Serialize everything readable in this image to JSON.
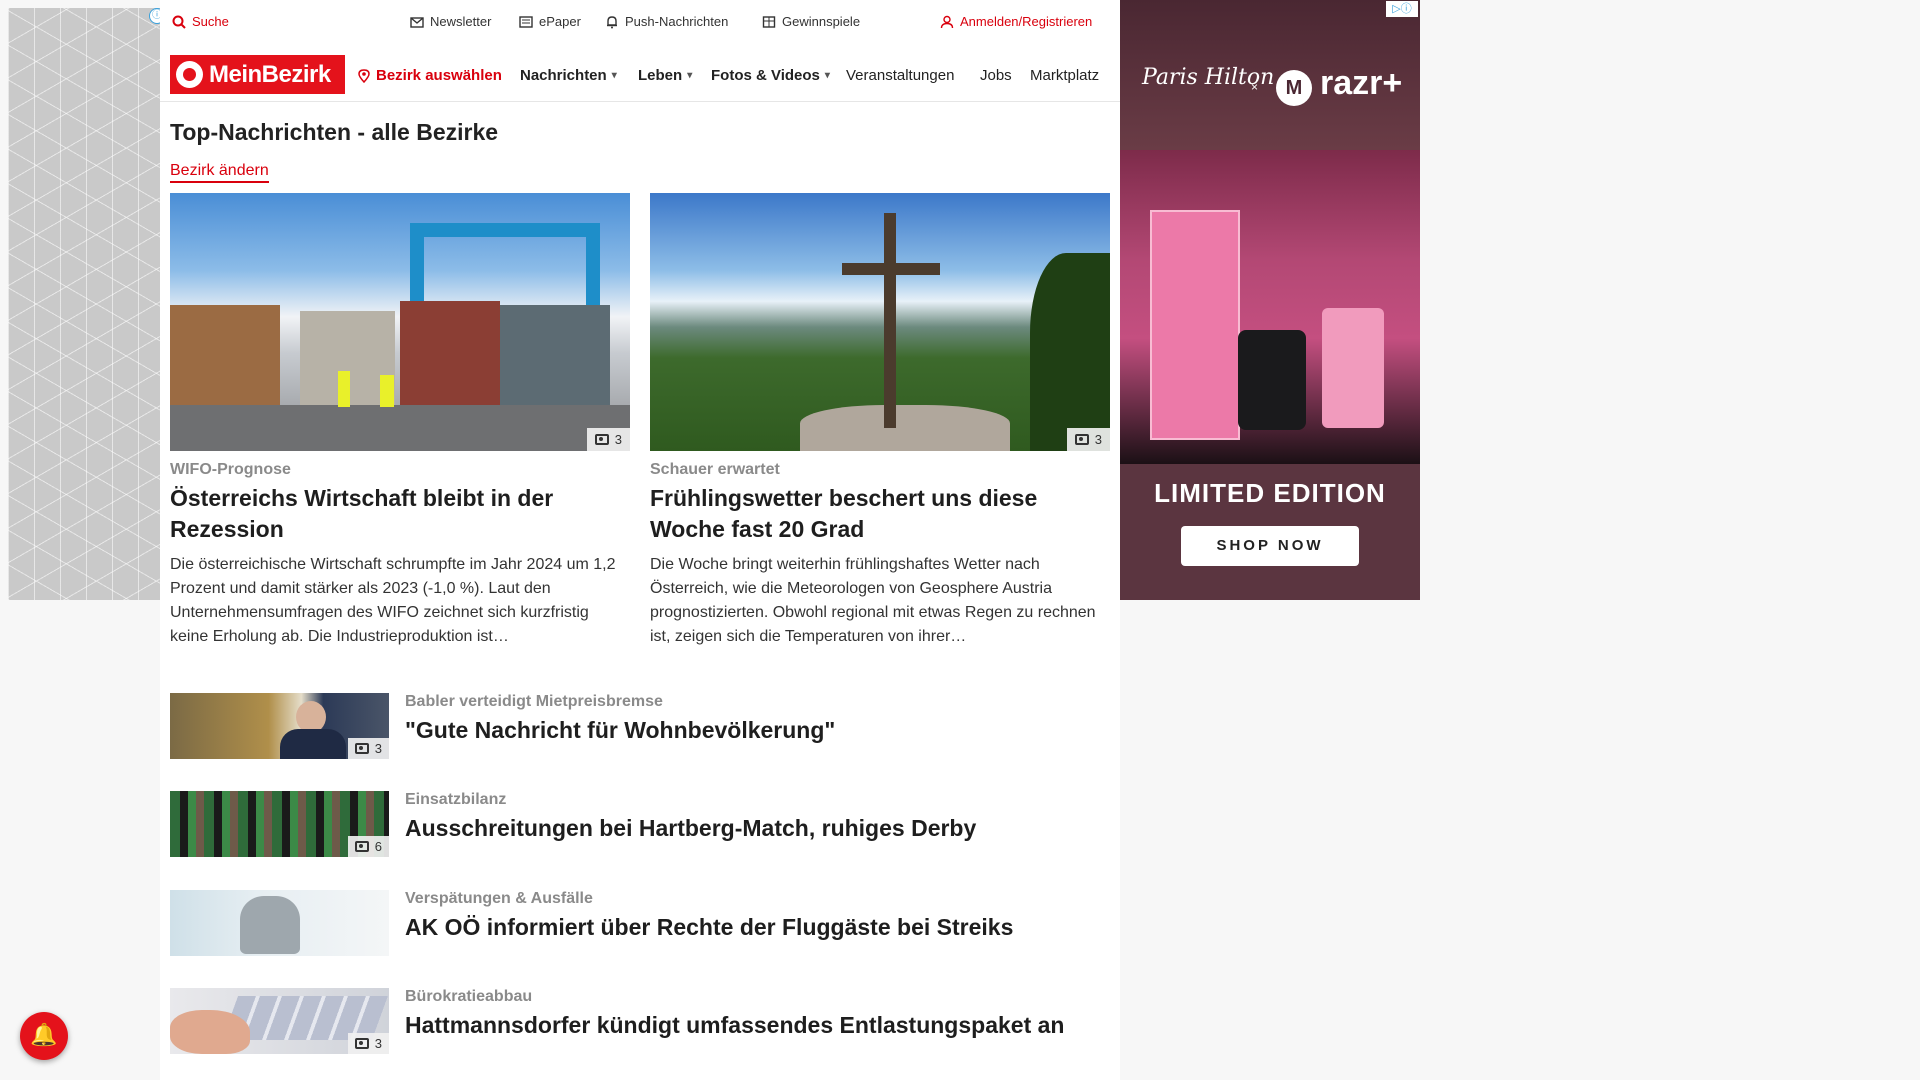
{
  "topbar": {
    "search": "Suche",
    "newsletter": "Newsletter",
    "epaper": "ePaper",
    "push": "Push-Nachrichten",
    "gewinnspiele": "Gewinnspiele",
    "login": "Anmelden/Registrieren"
  },
  "nav": {
    "logo": "MeinBezirk",
    "bezirk": "Bezirk auswählen",
    "items": [
      "Nachrichten",
      "Leben",
      "Fotos & Videos",
      "Veranstaltungen",
      "Jobs",
      "Marktplatz"
    ]
  },
  "page": {
    "title": "Top-Nachrichten - alle Bezirke",
    "bezirk_link": "Bezirk ändern"
  },
  "featured": [
    {
      "kicker": "WIFO-Prognose",
      "title": "Österreichs Wirtschaft bleibt in der Rezession",
      "text": "Die österreichische Wirtschaft schrumpfte im Jahr 2024 um 1,2 Prozent und damit stärker als 2023 (-1,0 %). Laut den Unternehmensumfragen des WIFO zeichnet sich kurzfristig keine Erholung ab. Die Industrieproduktion ist…",
      "photos": "3"
    },
    {
      "kicker": "Schauer erwartet",
      "title": "Frühlingswetter beschert uns diese Woche fast 20 Grad",
      "text": "Die Woche bringt weiterhin frühlingshaftes Wetter nach Österreich, wie die Meteorologen von Geosphere Austria prognostizierten. Obwohl regional mit etwas Regen zu rechnen ist, zeigen sich die Temperaturen von ihrer…",
      "photos": "3"
    }
  ],
  "list": [
    {
      "kicker": "Babler verteidigt Mietpreisbremse",
      "title": "\"Gute Nachricht für Wohnbevölkerung\"",
      "photos": "3"
    },
    {
      "kicker": "Einsatzbilanz",
      "title": "Ausschreitungen bei Hartberg-Match, ruhiges Derby",
      "photos": "6"
    },
    {
      "kicker": "Verspätungen & Ausfälle",
      "title": "AK OÖ informiert über Rechte der Fluggäste bei Streiks",
      "photos": ""
    },
    {
      "kicker": "Bürokratieabbau",
      "title": "Hattmannsdorfer kündigt umfassendes Entlastungspaket an",
      "photos": "3"
    }
  ],
  "ad": {
    "brand": "Paris Hilton",
    "x": "×",
    "moto": "M",
    "razr": "razr+",
    "limited": "LIMITED EDITION",
    "shop": "SHOP NOW"
  },
  "icons": {
    "info": "ⓘ",
    "adchoice": "▷ⓘ",
    "bell": "🔔"
  },
  "colors": {
    "brand_red": "#e4121b",
    "link_red": "#d9000d"
  }
}
